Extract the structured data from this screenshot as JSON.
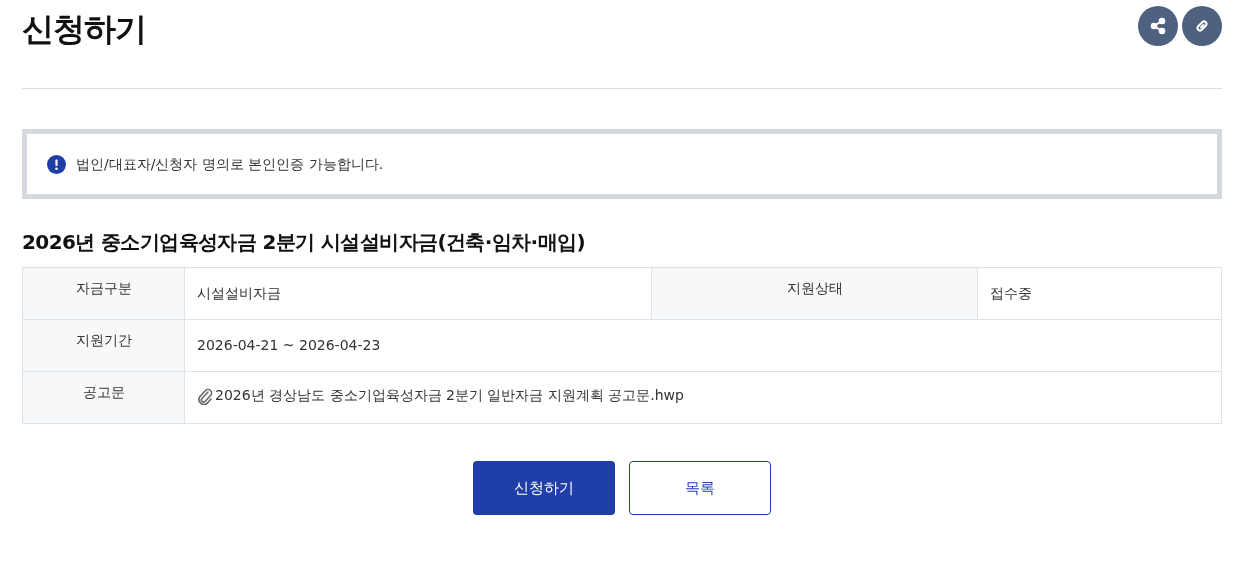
{
  "page": {
    "title": "신청하기"
  },
  "header_actions": [
    {
      "kind": "share"
    },
    {
      "kind": "link"
    }
  ],
  "notice": {
    "text": "법인/대표자/신청자 명의로 본인인증 가능합니다."
  },
  "program": {
    "title": "2026년 중소기업육성자금 2분기 시설설비자금(건축·임차·매입)"
  },
  "table": {
    "rows": [
      {
        "cells": [
          {
            "kind": "label",
            "text": "자금구분"
          },
          {
            "kind": "value",
            "text": "시설설비자금"
          },
          {
            "kind": "label",
            "text": "지원상태"
          },
          {
            "kind": "value",
            "text": "접수중"
          }
        ]
      },
      {
        "cells": [
          {
            "kind": "label",
            "text": "지원기간"
          },
          {
            "kind": "value",
            "text": "2026-04-21 ~ 2026-04-23",
            "colspan": 3
          }
        ]
      },
      {
        "cells": [
          {
            "kind": "label",
            "text": "공고문"
          },
          {
            "kind": "file",
            "text": "2026년 경상남도 중소기업육성자금 2분기 일반자금 지원계획 공고문.hwp",
            "colspan": 3
          }
        ]
      }
    ]
  },
  "buttons": [
    {
      "kind": "primary",
      "label": "신청하기"
    },
    {
      "kind": "outline",
      "label": "목록"
    }
  ]
}
